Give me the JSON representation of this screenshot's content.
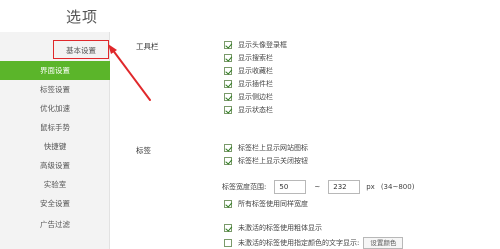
{
  "header": {
    "title": "选项"
  },
  "sidebar": {
    "items": [
      {
        "label": "基本设置"
      },
      {
        "label": "界面设置"
      },
      {
        "label": "标签设置"
      },
      {
        "label": "优化加速"
      },
      {
        "label": "鼠标手势"
      },
      {
        "label": "快捷键"
      },
      {
        "label": "高级设置"
      },
      {
        "label": "实验室"
      },
      {
        "label": "安全设置"
      },
      {
        "label": "广告过滤"
      }
    ]
  },
  "toolbar_section": {
    "label": "工具栏",
    "options": [
      {
        "label": "显示头像登录框",
        "checked": true
      },
      {
        "label": "显示搜索栏",
        "checked": true
      },
      {
        "label": "显示收藏栏",
        "checked": true
      },
      {
        "label": "显示插件栏",
        "checked": true
      },
      {
        "label": "显示侧边栏",
        "checked": true
      },
      {
        "label": "显示状态栏",
        "checked": true
      }
    ]
  },
  "tabs_section": {
    "label": "标签",
    "options": [
      {
        "label": "标签栏上显示网站图标",
        "checked": true
      },
      {
        "label": "标签栏上显示关闭按钮",
        "checked": true
      }
    ],
    "width_range": {
      "label": "标签宽度范围:",
      "min": "50",
      "tilde": "~",
      "max": "232",
      "unit": "px",
      "hint": "(34~800)"
    },
    "same_width": {
      "label": "所有标签使用同样宽度",
      "checked": true
    },
    "active_bold": {
      "label": "未激活的标签使用粗体显示",
      "checked": true
    },
    "inactive_color": {
      "label": "未激活的标签使用指定颜色的文字显示:",
      "checked": false,
      "button": "设置颜色"
    }
  },
  "colors": {
    "accent": "#5bb52a",
    "highlight": "#e0282b"
  }
}
